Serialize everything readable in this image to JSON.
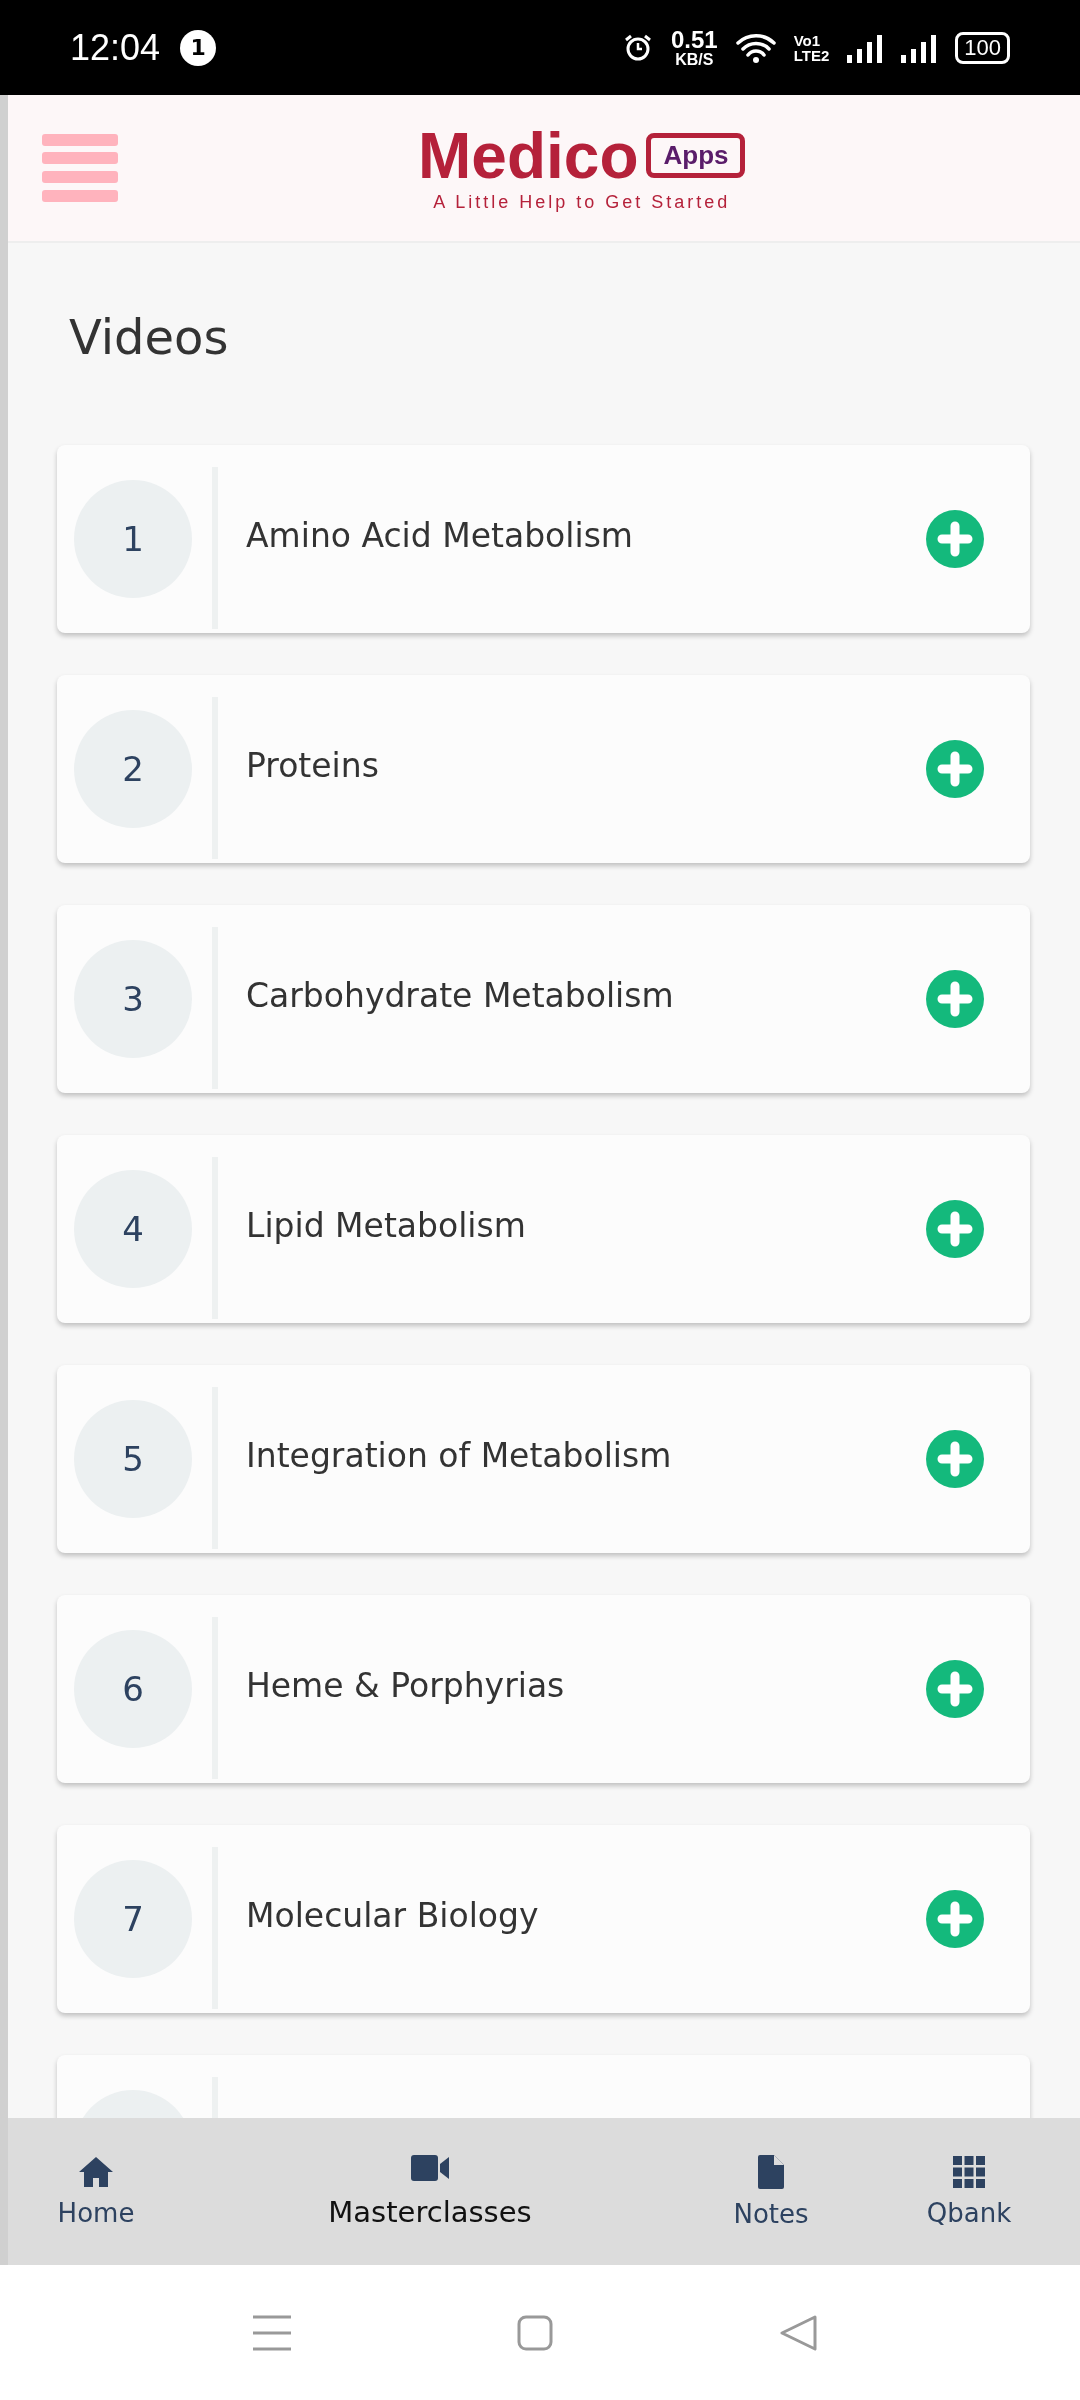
{
  "status_bar": {
    "time": "12:04",
    "notification_count": "1",
    "net_speed": "0.51",
    "net_unit": "KB/S",
    "volte_top": "Vo1",
    "volte_bottom": "LTE2",
    "battery": "100"
  },
  "header": {
    "logo": "Medico",
    "logo_badge": "Apps",
    "tagline": "A Little Help to Get Started"
  },
  "page_title": "Videos",
  "videos": [
    {
      "number": "1",
      "title": "Amino Acid Metabolism"
    },
    {
      "number": "2",
      "title": "Proteins"
    },
    {
      "number": "3",
      "title": "Carbohydrate Metabolism"
    },
    {
      "number": "4",
      "title": "Lipid Metabolism"
    },
    {
      "number": "5",
      "title": "Integration of Metabolism"
    },
    {
      "number": "6",
      "title": "Heme & Porphyrias"
    },
    {
      "number": "7",
      "title": "Molecular Biology"
    }
  ],
  "more_below": true,
  "bottom_nav": [
    {
      "kind": "home",
      "label": "Home",
      "selected": false
    },
    {
      "kind": "video",
      "label": "Masterclasses",
      "selected": true
    },
    {
      "kind": "notes",
      "label": "Notes",
      "selected": false
    },
    {
      "kind": "grid",
      "label": "Qbank",
      "selected": false
    }
  ]
}
